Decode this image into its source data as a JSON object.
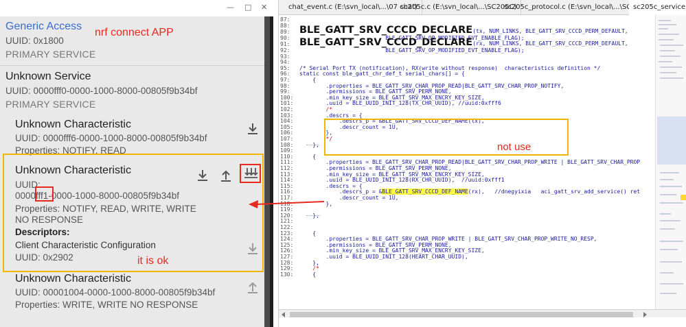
{
  "window": {
    "minimize": "—",
    "restore": "□",
    "close": "✕"
  },
  "phone": {
    "generic_access": {
      "title": "Generic Access",
      "uuid": "UUID: 0x1800",
      "type": "PRIMARY SERVICE"
    },
    "unknown_service": {
      "title": "Unknown Service",
      "uuid": "UUID: 0000fff0-0000-1000-8000-00805f9b34bf",
      "type": "PRIMARY SERVICE"
    },
    "char1": {
      "title": "Unknown Characteristic",
      "uuid": "UUID: 0000fff6-0000-1000-8000-00805f9b34bf",
      "properties": "Properties: NOTIFY, READ"
    },
    "char2": {
      "title": "Unknown Characteristic",
      "uuid_label": "UUID:",
      "uuid_prefix": "0000",
      "uuid_mid": "fff1",
      "uuid_suffix": "-0000-1000-8000-00805f9b34bf",
      "properties_line1": "Properties: NOTIFY, READ, WRITE, WRITE",
      "properties_line2": "NO RESPONSE",
      "descriptors_label": "Descriptors:",
      "descriptor_name": "Client Characteristic Configuration",
      "descriptor_uuid": "UUID: 0x2902"
    },
    "char3": {
      "title": "Unknown Characteristic",
      "uuid": "UUID: 00001004-0000-1000-8000-00805f9b34bf",
      "properties": "Properties: WRITE, WRITE NO RESPONSE"
    },
    "annotations": {
      "app_label": "nrf connect APP",
      "ok_label": "it is ok"
    }
  },
  "editor": {
    "tabs": [
      "chat_event.c (E:\\svn_local\\...\\07 chat)",
      "sc205c.c (E:\\svn_local\\...\\SC205C)",
      "sc205c_protocol.c (E:\\svn_local\\...\\SC205C)",
      "sc205c_service.c (E:\\sv"
    ],
    "not_use_label": "not use",
    "lines": [
      {
        "n": "87:",
        "t": ""
      },
      {
        "n": "88:",
        "t": ""
      },
      {
        "n": "89:",
        "big": "BLE_GATT_SRV_CCCD_DECLARE",
        "t": "(tx, NUM_LINKS, BLE_GATT_SRV_CCCD_PERM_DEFAULT,"
      },
      {
        "n": "90:",
        "t": "                          BLE_GATT_SRV_OP_MODIFIED_EVT_ENABLE_FLAG);"
      },
      {
        "n": "91:",
        "big": "BLE_GATT_SRV_CCCD_DECLARE",
        "t": "(rx, NUM_LINKS, BLE_GATT_SRV_CCCD_PERM_DEFAULT,"
      },
      {
        "n": "92:",
        "t": "                          BLE_GATT_SRV_OP_MODIFIED_EVT_ENABLE_FLAG);"
      },
      {
        "n": "93:",
        "t": ""
      },
      {
        "n": "94:",
        "t": ""
      },
      {
        "n": "95:",
        "t": "/* Serial Port TX (notification), RX(write without response)  characteristics definition */"
      },
      {
        "n": "96:",
        "t": "static const ble_gatt_chr_def_t serial_chars[] = {"
      },
      {
        "n": "97:",
        "t": "    {"
      },
      {
        "n": "98:",
        "t": "        .properties = BLE_GATT_SRV_CHAR_PROP_READ|BLE_GATT_SRV_CHAR_PROP_NOTIFY,"
      },
      {
        "n": "99:",
        "t": "        .permissions = BLE_GATT_SRV_PERM_NONE,"
      },
      {
        "n": "100:",
        "t": "        .min_key_size = BLE_GATT_SRV_MAX_ENCRY_KEY_SIZE,"
      },
      {
        "n": "101:",
        "t": "        .uuid = BLE_UUID_INIT_128(TX_CHR_UUID), //uuid:0xfff6"
      },
      {
        "n": "102:",
        "t": "        /*",
        "cls": "red"
      },
      {
        "n": "103:",
        "t": "        .descrs = {"
      },
      {
        "n": "104:",
        "t": "            .descrs_p = &BLE_GATT_SRV_CCCD_DEF_NAME(tx),"
      },
      {
        "n": "105:",
        "t": "            .descr_count = 1U,"
      },
      {
        "n": "106:",
        "t": "        },"
      },
      {
        "n": "107:",
        "t": "        */",
        "cls": "red"
      },
      {
        "n": "108:",
        "t": "    },"
      },
      {
        "n": "109:",
        "t": ""
      },
      {
        "n": "110:",
        "t": "    {"
      },
      {
        "n": "111:",
        "t": "        .properties = BLE_GATT_SRV_CHAR_PROP_READ|BLE_GATT_SRV_CHAR_PROP_WRITE | BLE_GATT_SRV_CHAR_PROP"
      },
      {
        "n": "112:",
        "t": "        .permissions = BLE_GATT_SRV_PERM_NONE,"
      },
      {
        "n": "113:",
        "t": "        .min_key_size = BLE_GATT_SRV_MAX_ENCRY_KEY_SIZE,"
      },
      {
        "n": "114:",
        "t": "        .uuid = BLE_UUID_INIT_128(RX_CHR_UUID),  //uuid:0xfff1"
      },
      {
        "n": "115:",
        "t": "        .descrs = {"
      },
      {
        "n": "116:",
        "t": "            .descrs_p = &",
        "hl": "BLE_GATT_SRV_CCCD_DEF_NAME",
        "t2": "(rx),   //dnegyixia   aci_gatt_srv_add_service() ret"
      },
      {
        "n": "117:",
        "t": "            .descr_count = 1U,"
      },
      {
        "n": "118:",
        "t": "        },"
      },
      {
        "n": "119:",
        "t": ""
      },
      {
        "n": "120:",
        "t": "    },"
      },
      {
        "n": "121:",
        "t": ""
      },
      {
        "n": "122:",
        "t": ""
      },
      {
        "n": "123:",
        "t": "    {"
      },
      {
        "n": "124:",
        "t": "        .properties = BLE_GATT_SRV_CHAR_PROP_WRITE | BLE_GATT_SRV_CHAR_PROP_WRITE_NO_RESP,"
      },
      {
        "n": "125:",
        "t": "        .permissions = BLE_GATT_SRV_PERM_NONE,"
      },
      {
        "n": "126:",
        "t": "        .min_key_size = BLE_GATT_SRV_MAX_ENCRY_KEY_SIZE,"
      },
      {
        "n": "127:",
        "t": "        .uuid = BLE_UUID_INIT_128(HEART_CHAR_UUID),"
      },
      {
        "n": "128:",
        "t": "    },"
      },
      {
        "n": "129:",
        "t": "    /*",
        "cls": "red"
      },
      {
        "n": "130:",
        "t": "    {"
      }
    ]
  },
  "colors": {
    "annotation_red": "#e8281c",
    "annotation_orange": "#f5b400",
    "code_blue": "#1a1a9e",
    "highlight_yellow": "#ffff40"
  }
}
